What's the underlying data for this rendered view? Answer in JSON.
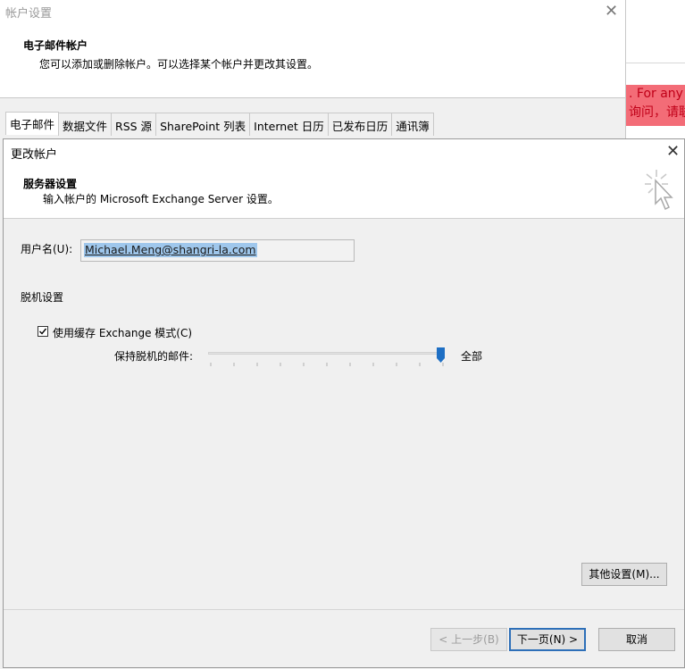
{
  "background": {
    "banner_line1": ". For any q",
    "banner_line2": "询问，请联系"
  },
  "account_settings": {
    "title": "帐户设置",
    "heading": "电子邮件帐户",
    "description": "您可以添加或删除帐户。可以选择某个帐户并更改其设置。",
    "tabs": [
      "电子邮件",
      "数据文件",
      "RSS 源",
      "SharePoint 列表",
      "Internet 日历",
      "已发布日历",
      "通讯簿"
    ],
    "active_tab": "电子邮件"
  },
  "change_account": {
    "title": "更改帐户",
    "heading": "服务器设置",
    "subheading": "输入帐户的 Microsoft Exchange Server 设置。",
    "username_label": "用户名(U):",
    "username_value": "Michael.Meng@shangri-la.com",
    "offline_label": "脱机设置",
    "cached_mode_label": "使用缓存 Exchange 模式(C)",
    "cached_mode_checked": true,
    "keep_offline_label": "保持脱机的邮件:",
    "keep_offline_value": "全部",
    "slider_fraction": 1.0,
    "more_settings": "其他设置(M)...",
    "prev_button": "< 上一步(B)",
    "next_button": "下一页(N) >",
    "cancel_button": "取消"
  },
  "colors": {
    "accent": "#2d6fb8",
    "selection": "#9fc7ec",
    "banner": "#f36c77",
    "slider_thumb": "#1e6fc4"
  }
}
